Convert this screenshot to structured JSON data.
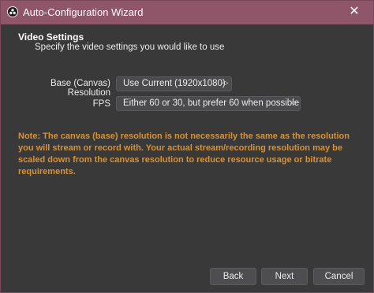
{
  "window": {
    "title": "Auto-Configuration Wizard",
    "close_glyph": "✕"
  },
  "section": {
    "title": "Video Settings",
    "subtitle": "Specify the video settings you would like to use"
  },
  "fields": {
    "base_resolution": {
      "label": "Base (Canvas) Resolution",
      "value": "Use Current (1920x1080)"
    },
    "fps": {
      "label": "FPS",
      "value": "Either 60 or 30, but prefer 60 when possible"
    }
  },
  "note": "Note: The canvas (base) resolution is not necessarily the same as the resolution you will stream or record with. Your actual stream/recording resolution may be scaled down from the canvas resolution to reduce resource usage or bitrate requirements.",
  "buttons": {
    "back": "Back",
    "next": "Next",
    "cancel": "Cancel"
  },
  "colors": {
    "titlebar": "#8e5668",
    "window_bg": "#3a393a",
    "note_text": "#d69237"
  },
  "icons": {
    "app": "obs-logo-icon",
    "spinner": "chevron-up-down-icon"
  }
}
